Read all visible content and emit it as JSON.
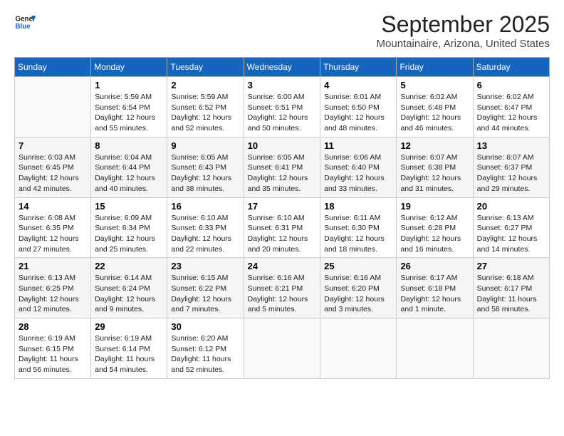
{
  "header": {
    "logo_general": "General",
    "logo_blue": "Blue",
    "month": "September 2025",
    "location": "Mountainaire, Arizona, United States"
  },
  "weekdays": [
    "Sunday",
    "Monday",
    "Tuesday",
    "Wednesday",
    "Thursday",
    "Friday",
    "Saturday"
  ],
  "weeks": [
    [
      {
        "day": "",
        "sunrise": "",
        "sunset": "",
        "daylight": ""
      },
      {
        "day": "1",
        "sunrise": "Sunrise: 5:59 AM",
        "sunset": "Sunset: 6:54 PM",
        "daylight": "Daylight: 12 hours and 55 minutes."
      },
      {
        "day": "2",
        "sunrise": "Sunrise: 5:59 AM",
        "sunset": "Sunset: 6:52 PM",
        "daylight": "Daylight: 12 hours and 52 minutes."
      },
      {
        "day": "3",
        "sunrise": "Sunrise: 6:00 AM",
        "sunset": "Sunset: 6:51 PM",
        "daylight": "Daylight: 12 hours and 50 minutes."
      },
      {
        "day": "4",
        "sunrise": "Sunrise: 6:01 AM",
        "sunset": "Sunset: 6:50 PM",
        "daylight": "Daylight: 12 hours and 48 minutes."
      },
      {
        "day": "5",
        "sunrise": "Sunrise: 6:02 AM",
        "sunset": "Sunset: 6:48 PM",
        "daylight": "Daylight: 12 hours and 46 minutes."
      },
      {
        "day": "6",
        "sunrise": "Sunrise: 6:02 AM",
        "sunset": "Sunset: 6:47 PM",
        "daylight": "Daylight: 12 hours and 44 minutes."
      }
    ],
    [
      {
        "day": "7",
        "sunrise": "Sunrise: 6:03 AM",
        "sunset": "Sunset: 6:45 PM",
        "daylight": "Daylight: 12 hours and 42 minutes."
      },
      {
        "day": "8",
        "sunrise": "Sunrise: 6:04 AM",
        "sunset": "Sunset: 6:44 PM",
        "daylight": "Daylight: 12 hours and 40 minutes."
      },
      {
        "day": "9",
        "sunrise": "Sunrise: 6:05 AM",
        "sunset": "Sunset: 6:43 PM",
        "daylight": "Daylight: 12 hours and 38 minutes."
      },
      {
        "day": "10",
        "sunrise": "Sunrise: 6:05 AM",
        "sunset": "Sunset: 6:41 PM",
        "daylight": "Daylight: 12 hours and 35 minutes."
      },
      {
        "day": "11",
        "sunrise": "Sunrise: 6:06 AM",
        "sunset": "Sunset: 6:40 PM",
        "daylight": "Daylight: 12 hours and 33 minutes."
      },
      {
        "day": "12",
        "sunrise": "Sunrise: 6:07 AM",
        "sunset": "Sunset: 6:38 PM",
        "daylight": "Daylight: 12 hours and 31 minutes."
      },
      {
        "day": "13",
        "sunrise": "Sunrise: 6:07 AM",
        "sunset": "Sunset: 6:37 PM",
        "daylight": "Daylight: 12 hours and 29 minutes."
      }
    ],
    [
      {
        "day": "14",
        "sunrise": "Sunrise: 6:08 AM",
        "sunset": "Sunset: 6:35 PM",
        "daylight": "Daylight: 12 hours and 27 minutes."
      },
      {
        "day": "15",
        "sunrise": "Sunrise: 6:09 AM",
        "sunset": "Sunset: 6:34 PM",
        "daylight": "Daylight: 12 hours and 25 minutes."
      },
      {
        "day": "16",
        "sunrise": "Sunrise: 6:10 AM",
        "sunset": "Sunset: 6:33 PM",
        "daylight": "Daylight: 12 hours and 22 minutes."
      },
      {
        "day": "17",
        "sunrise": "Sunrise: 6:10 AM",
        "sunset": "Sunset: 6:31 PM",
        "daylight": "Daylight: 12 hours and 20 minutes."
      },
      {
        "day": "18",
        "sunrise": "Sunrise: 6:11 AM",
        "sunset": "Sunset: 6:30 PM",
        "daylight": "Daylight: 12 hours and 18 minutes."
      },
      {
        "day": "19",
        "sunrise": "Sunrise: 6:12 AM",
        "sunset": "Sunset: 6:28 PM",
        "daylight": "Daylight: 12 hours and 16 minutes."
      },
      {
        "day": "20",
        "sunrise": "Sunrise: 6:13 AM",
        "sunset": "Sunset: 6:27 PM",
        "daylight": "Daylight: 12 hours and 14 minutes."
      }
    ],
    [
      {
        "day": "21",
        "sunrise": "Sunrise: 6:13 AM",
        "sunset": "Sunset: 6:25 PM",
        "daylight": "Daylight: 12 hours and 12 minutes."
      },
      {
        "day": "22",
        "sunrise": "Sunrise: 6:14 AM",
        "sunset": "Sunset: 6:24 PM",
        "daylight": "Daylight: 12 hours and 9 minutes."
      },
      {
        "day": "23",
        "sunrise": "Sunrise: 6:15 AM",
        "sunset": "Sunset: 6:22 PM",
        "daylight": "Daylight: 12 hours and 7 minutes."
      },
      {
        "day": "24",
        "sunrise": "Sunrise: 6:16 AM",
        "sunset": "Sunset: 6:21 PM",
        "daylight": "Daylight: 12 hours and 5 minutes."
      },
      {
        "day": "25",
        "sunrise": "Sunrise: 6:16 AM",
        "sunset": "Sunset: 6:20 PM",
        "daylight": "Daylight: 12 hours and 3 minutes."
      },
      {
        "day": "26",
        "sunrise": "Sunrise: 6:17 AM",
        "sunset": "Sunset: 6:18 PM",
        "daylight": "Daylight: 12 hours and 1 minute."
      },
      {
        "day": "27",
        "sunrise": "Sunrise: 6:18 AM",
        "sunset": "Sunset: 6:17 PM",
        "daylight": "Daylight: 11 hours and 58 minutes."
      }
    ],
    [
      {
        "day": "28",
        "sunrise": "Sunrise: 6:19 AM",
        "sunset": "Sunset: 6:15 PM",
        "daylight": "Daylight: 11 hours and 56 minutes."
      },
      {
        "day": "29",
        "sunrise": "Sunrise: 6:19 AM",
        "sunset": "Sunset: 6:14 PM",
        "daylight": "Daylight: 11 hours and 54 minutes."
      },
      {
        "day": "30",
        "sunrise": "Sunrise: 6:20 AM",
        "sunset": "Sunset: 6:12 PM",
        "daylight": "Daylight: 11 hours and 52 minutes."
      },
      {
        "day": "",
        "sunrise": "",
        "sunset": "",
        "daylight": ""
      },
      {
        "day": "",
        "sunrise": "",
        "sunset": "",
        "daylight": ""
      },
      {
        "day": "",
        "sunrise": "",
        "sunset": "",
        "daylight": ""
      },
      {
        "day": "",
        "sunrise": "",
        "sunset": "",
        "daylight": ""
      }
    ]
  ]
}
